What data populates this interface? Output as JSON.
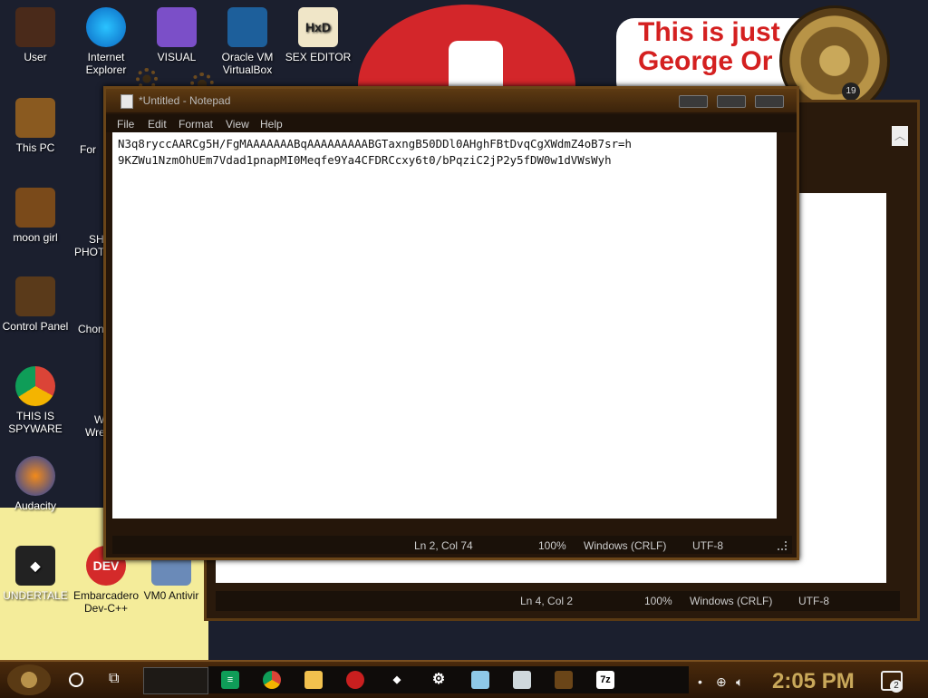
{
  "desktop": {
    "icons": [
      {
        "label": "User"
      },
      {
        "label": "Internet Explorer"
      },
      {
        "label": "VISUAL"
      },
      {
        "label": "Oracle VM VirtualBox"
      },
      {
        "label": "SEX EDITOR"
      },
      {
        "label": "This PC"
      },
      {
        "label": "moon girl"
      },
      {
        "label": "Control Panel"
      },
      {
        "label": "THIS IS SPYWARE"
      },
      {
        "label": "Audacity"
      },
      {
        "label": "UNDERTALE"
      },
      {
        "label": "Embarcadero Dev-C++"
      },
      {
        "label": "VM0 Antivir"
      }
    ],
    "partial_labels": {
      "p1": "For",
      "p2": "SH",
      "p3": "PHOTO",
      "p4": "Chon",
      "p5": "W",
      "p6": "Wrea"
    },
    "wallpaper_text": {
      "line1": "This is just",
      "line2": "George Or"
    },
    "clock_number": "19"
  },
  "background_window": {
    "status": {
      "position": "Ln 4, Col 2",
      "zoom": "100%",
      "line_ending": "Windows (CRLF)",
      "encoding": "UTF-8"
    }
  },
  "notepad": {
    "title": "*Untitled - Notepad",
    "menu": [
      "File",
      "Edit",
      "Format",
      "View",
      "Help"
    ],
    "content_lines": [
      "N3q8ryccAARCg5H/FgMAAAAAAABqAAAAAAAAABGTaxngB50DDl0AHghFBtDvqCgXWdmZ4oB7sr=h",
      "9KZWu1NzmOhUEm7Vdad1pnapMI0Meqfe9Ya4CFDRCcxy6t0/bPqziC2jP2y5fDW0w1dVWsWyh"
    ],
    "status": {
      "position": "Ln 2, Col 74",
      "zoom": "100%",
      "line_ending": "Windows (CRLF)",
      "encoding": "UTF-8"
    }
  },
  "taskbar": {
    "time": "2:05 PM",
    "notification_count": "2",
    "pinned": [
      {
        "name": "google-sheets-icon"
      },
      {
        "name": "chrome-icon"
      },
      {
        "name": "file-explorer-icon"
      },
      {
        "name": "red-app-icon"
      },
      {
        "name": "unity-icon"
      },
      {
        "name": "settings-icon"
      },
      {
        "name": "notepad-icon"
      },
      {
        "name": "window-icon"
      },
      {
        "name": "steampunk-app-icon"
      },
      {
        "name": "7zip-icon",
        "label": "7z"
      }
    ]
  },
  "colors": {
    "accent_gold": "#c9a85a",
    "frame_brown": "#6a4518",
    "red_disc": "#d3262a"
  }
}
